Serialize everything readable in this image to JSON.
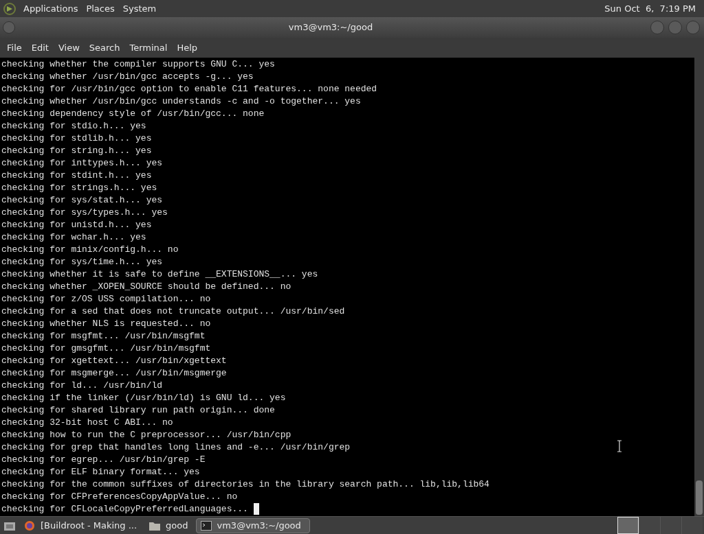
{
  "top_panel": {
    "menus": [
      "Applications",
      "Places",
      "System"
    ],
    "clock": "Sun Oct  6,  7:19 PM"
  },
  "window": {
    "title": "vm3@vm3:~/good"
  },
  "menubar": [
    "File",
    "Edit",
    "View",
    "Search",
    "Terminal",
    "Help"
  ],
  "terminal": {
    "lines": [
      "checking whether the compiler supports GNU C... yes",
      "checking whether /usr/bin/gcc accepts -g... yes",
      "checking for /usr/bin/gcc option to enable C11 features... none needed",
      "checking whether /usr/bin/gcc understands -c and -o together... yes",
      "checking dependency style of /usr/bin/gcc... none",
      "checking for stdio.h... yes",
      "checking for stdlib.h... yes",
      "checking for string.h... yes",
      "checking for inttypes.h... yes",
      "checking for stdint.h... yes",
      "checking for strings.h... yes",
      "checking for sys/stat.h... yes",
      "checking for sys/types.h... yes",
      "checking for unistd.h... yes",
      "checking for wchar.h... yes",
      "checking for minix/config.h... no",
      "checking for sys/time.h... yes",
      "checking whether it is safe to define __EXTENSIONS__... yes",
      "checking whether _XOPEN_SOURCE should be defined... no",
      "checking for z/OS USS compilation... no",
      "checking for a sed that does not truncate output... /usr/bin/sed",
      "checking whether NLS is requested... no",
      "checking for msgfmt... /usr/bin/msgfmt",
      "checking for gmsgfmt... /usr/bin/msgfmt",
      "checking for xgettext... /usr/bin/xgettext",
      "checking for msgmerge... /usr/bin/msgmerge",
      "checking for ld... /usr/bin/ld",
      "checking if the linker (/usr/bin/ld) is GNU ld... yes",
      "checking for shared library run path origin... done",
      "checking 32-bit host C ABI... no",
      "checking how to run the C preprocessor... /usr/bin/cpp",
      "checking for grep that handles long lines and -e... /usr/bin/grep",
      "checking for egrep... /usr/bin/grep -E",
      "checking for ELF binary format... yes",
      "checking for the common suffixes of directories in the library search path... lib,lib,lib64",
      "checking for CFPreferencesCopyAppValue... no",
      "checking for CFLocaleCopyPreferredLanguages... "
    ]
  },
  "taskbar": {
    "items": [
      {
        "kind": "browser",
        "label": "[Buildroot - Making ...",
        "selected": false
      },
      {
        "kind": "folder",
        "label": "good",
        "selected": false
      },
      {
        "kind": "terminal",
        "label": "vm3@vm3:~/good",
        "selected": true
      }
    ],
    "workspaces": [
      {
        "selected": true
      },
      {
        "selected": false
      },
      {
        "selected": false
      },
      {
        "selected": false
      }
    ]
  }
}
